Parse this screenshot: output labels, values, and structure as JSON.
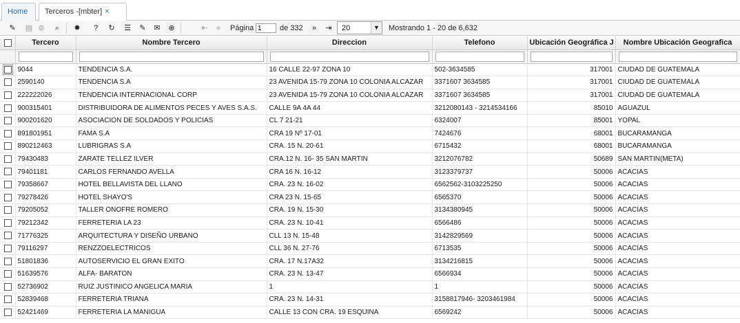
{
  "tabs": [
    {
      "label": "Home"
    },
    {
      "label": "Terceros -[mbter]",
      "close": "×"
    }
  ],
  "toolbar": {
    "icons": [
      "edit-icon",
      "save-icon",
      "cancel-icon",
      "search-icon",
      "settings-icon",
      "help-icon",
      "refresh-icon",
      "chat-icon",
      "pin-icon",
      "mail-icon",
      "add-icon",
      "first-page-icon",
      "prev-page-icon",
      "next-page-icon",
      "last-page-icon"
    ],
    "page_label": "Página",
    "page_value": "1",
    "page_of": "de 332",
    "page_size": "20",
    "showing": "Mostrando 1 - 20 de 6,632"
  },
  "table": {
    "columns": [
      "Tercero",
      "Nombre Tercero",
      "Direccion",
      "Telefono",
      "Ubicación Geográfica J",
      "Nombre Ubicación Geografica"
    ],
    "rows": [
      [
        "9044",
        "TENDENCIA S.A.",
        "16 CALLE 22-97 ZONA 10",
        "502-3634585",
        "317001",
        "CIUDAD DE GUATEMALA"
      ],
      [
        "2590140",
        "TENDENCIA S.A",
        "23 AVENIDA 15-79 ZONA 10 COLONIA ALCAZAR",
        "3371607   3634585",
        "317001",
        "CIUDAD DE GUATEMALA"
      ],
      [
        "222222026",
        "TENDENCIA INTERNACIONAL CORP",
        "23 AVENIDA 15-79 ZONA 10 COLONIA ALCAZAR",
        "3371607   3634585",
        "317001",
        "CIUDAD DE GUATEMALA"
      ],
      [
        "900315401",
        "DISTRIBUIDORA DE ALIMENTOS PECES Y AVES S.A.S.",
        "CALLE 9A 4A 44",
        "3212080143 - 3214534166",
        "85010",
        "AGUAZUL"
      ],
      [
        "900201620",
        "ASOCIACION DE SOLDADOS Y POLICIAS",
        "CL 7 21-21",
        "6324007",
        "85001",
        "YOPAL"
      ],
      [
        "891801951",
        "FAMA S.A",
        "CRA 19 Nº 17-01",
        "7424676",
        "68001",
        "BUCARAMANGA"
      ],
      [
        "890212463",
        "LUBRIGRAS S.A",
        "CRA. 15 N. 20-61",
        "6715432",
        "68001",
        "BUCARAMANGA"
      ],
      [
        "79430483",
        "ZARATE TELLEZ ILVER",
        "CRA.12 N. 16- 35 SAN MARTIN",
        "3212076782",
        "50689",
        "SAN MARTIN(META)"
      ],
      [
        "79401181",
        "CARLOS FERNANDO AVELLA",
        "CRA 16 N. 16-12",
        "3123379737",
        "50006",
        "ACACIAS"
      ],
      [
        "79358667",
        "HOTEL BELLAVISTA DEL LLANO",
        "CRA. 23 N. 16-02",
        "6562562-3103225250",
        "50006",
        "ACACIAS"
      ],
      [
        "79278426",
        "HOTEL SHAYO'S",
        "CRA 23 N. 15-65",
        "6565370",
        "50006",
        "ACACIAS"
      ],
      [
        "79205052",
        "TALLER ONOFRE ROMERO",
        "CRA. 19 N. 15-30",
        "3134380945",
        "50006",
        "ACACIAS"
      ],
      [
        "79212342",
        "FERRETERIA LA 23",
        "CRA. 23 N. 10-41",
        "6566486",
        "50006",
        "ACACIAS"
      ],
      [
        "71776325",
        "ARQUITECTURA Y DISEÑO URBANO",
        "CLL 13 N. 15-48",
        "3142829569",
        "50006",
        "ACACIAS"
      ],
      [
        "79116297",
        "RENZZOELECTRICOS",
        "CLL 36 N. 27-76",
        "6713535",
        "50006",
        "ACACIAS"
      ],
      [
        "51801836",
        "AUTOSERVICIO EL GRAN EXITO",
        "CRA. 17 N.17A32",
        "3134216815",
        "50006",
        "ACACIAS"
      ],
      [
        "51639576",
        "ALFA- BARATON",
        "CRA. 23 N. 13-47",
        "6566934",
        "50006",
        "ACACIAS"
      ],
      [
        "52736902",
        "RUIZ  JUSTINICO ANGELICA  MARIA",
        "1",
        "1",
        "50006",
        "ACACIAS"
      ],
      [
        "52839468",
        "FERRETERIA TRIANA",
        "CRA. 23 N. 14-31",
        "3158817946- 3203461984",
        "50006",
        "ACACIAS"
      ],
      [
        "52421469",
        "FERRETERIA LA MANIGUA",
        "CALLE 13 CON CRA. 19 ESQUINA",
        "6569242",
        "50006",
        "ACACIAS"
      ]
    ]
  }
}
